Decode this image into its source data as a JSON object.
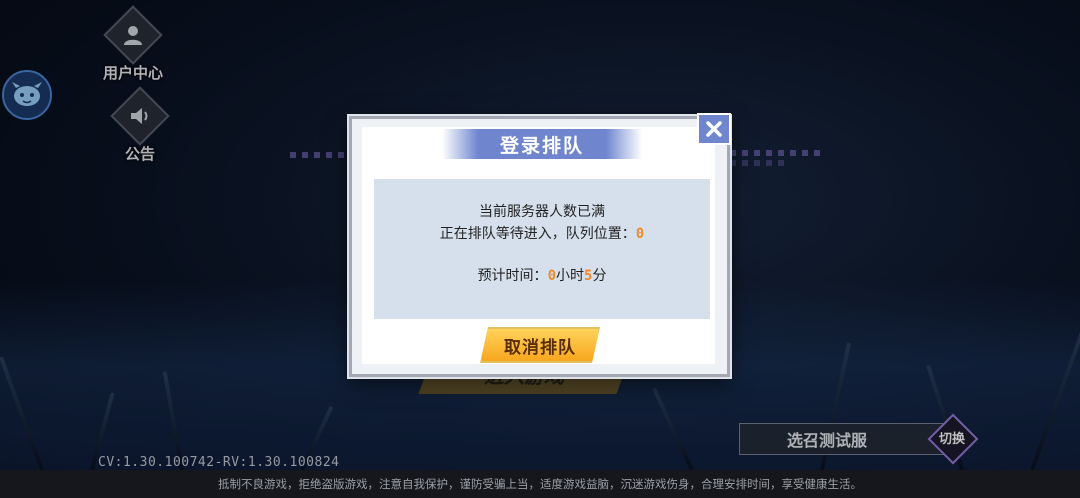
{
  "sidebar": {
    "user_center_label": "用户中心",
    "notice_label": "公告"
  },
  "modal": {
    "title": "登录排队",
    "line1": "当前服务器人数已满",
    "line2_prefix": "正在排队等待进入，队列位置：",
    "queue_position": "0",
    "eta_prefix": "预计时间：",
    "eta_hours": "0",
    "eta_hours_unit": "小时",
    "eta_minutes": "5",
    "eta_minutes_unit": "分",
    "cancel_label": "取消排队"
  },
  "enter_game_label": "进入游戏",
  "server": {
    "name": "选召测试服",
    "switch_label": "切换"
  },
  "version": "CV:1.30.100742-RV:1.30.100824",
  "footer_text": "抵制不良游戏，拒绝盗版游戏，注意自我保护，谨防受骗上当，适度游戏益脑，沉迷游戏伤身，合理安排时间，享受健康生活。",
  "colors": {
    "accent_orange": "#f08a2a",
    "title_blue": "#6f86cf",
    "button_yellow": "#f7a61e"
  }
}
